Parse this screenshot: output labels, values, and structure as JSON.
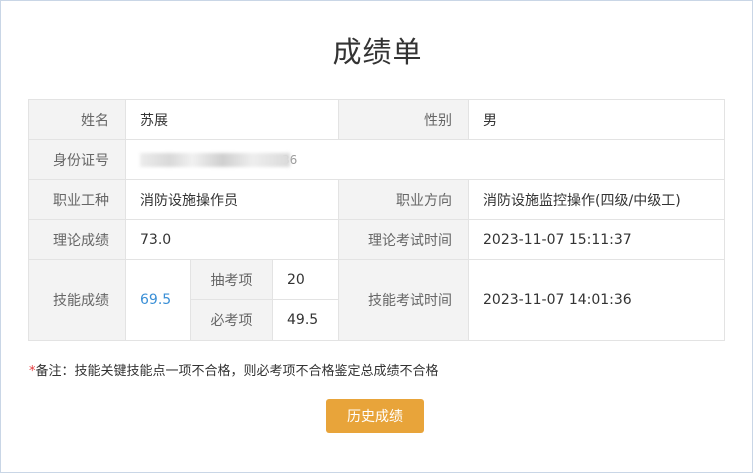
{
  "page": {
    "title": "成绩单"
  },
  "fields": {
    "name_label": "姓名",
    "name_value": "苏展",
    "gender_label": "性别",
    "gender_value": "男",
    "id_label": "身份证号",
    "id_value_visible": "36",
    "occupation_label": "职业工种",
    "occupation_value": "消防设施操作员",
    "direction_label": "职业方向",
    "direction_value": "消防设施监控操作(四级/中级工)",
    "theory_score_label": "理论成绩",
    "theory_score_value": "73.0",
    "theory_time_label": "理论考试时间",
    "theory_time_value": "2023-11-07 15:11:37",
    "skill_score_label": "技能成绩",
    "skill_score_value": "69.5",
    "sample_item_label": "抽考项",
    "sample_item_value": "20",
    "required_item_label": "必考项",
    "required_item_value": "49.5",
    "skill_time_label": "技能考试时间",
    "skill_time_value": "2023-11-07 14:01:36"
  },
  "note": {
    "star": "*",
    "text": "备注：技能关键技能点一项不合格，则必考项不合格鉴定总成绩不合格"
  },
  "actions": {
    "history_button": "历史成绩"
  },
  "colors": {
    "accent_button": "#e8a43a",
    "link_score": "#3a8fd6",
    "required_star": "#e4393c",
    "label_bg": "#f3f3f3"
  }
}
